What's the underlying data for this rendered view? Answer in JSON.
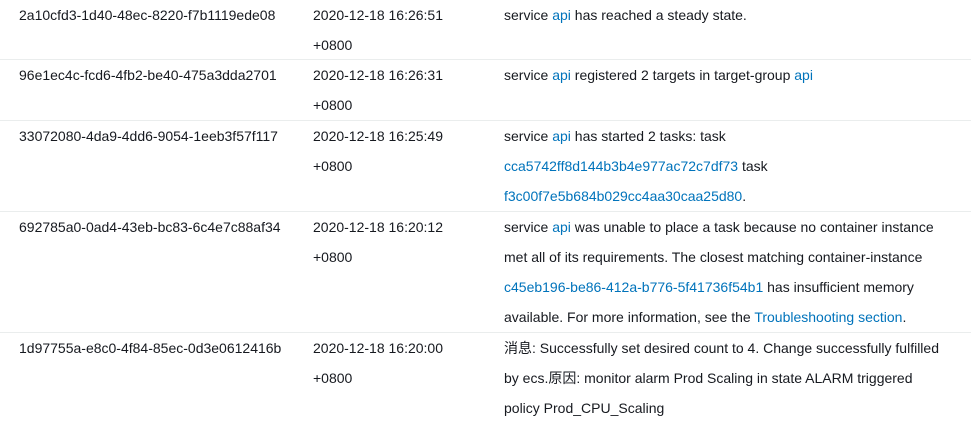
{
  "events": [
    {
      "id": "2a10cfd3-1d40-48ec-8220-f7b1119ede08",
      "time": "2020-12-18 16:26:51",
      "tz": "+0800",
      "msg_lines": [
        [
          {
            "t": "service "
          },
          {
            "t": "api",
            "link": true
          },
          {
            "t": " has reached a steady state."
          }
        ]
      ]
    },
    {
      "id": "96e1ec4c-fcd6-4fb2-be40-475a3dda2701",
      "time": "2020-12-18 16:26:31",
      "tz": "+0800",
      "msg_lines": [
        [
          {
            "t": "service "
          },
          {
            "t": "api",
            "link": true
          },
          {
            "t": " registered 2 targets in target-group "
          },
          {
            "t": "api",
            "link": true
          }
        ]
      ]
    },
    {
      "id": "33072080-4da9-4dd6-9054-1eeb3f57f117",
      "time": "2020-12-18 16:25:49",
      "tz": "+0800",
      "msg_lines": [
        [
          {
            "t": "service "
          },
          {
            "t": "api",
            "link": true
          },
          {
            "t": " has started 2 tasks: task"
          }
        ],
        [
          {
            "t": "cca5742ff8d144b3b4e977ac72c7df73",
            "link": true
          },
          {
            "t": " task"
          }
        ],
        [
          {
            "t": "f3c00f7e5b684b029cc4aa30caa25d80",
            "link": true
          },
          {
            "t": "."
          }
        ]
      ]
    },
    {
      "id": "692785a0-0ad4-43eb-bc83-6c4e7c88af34",
      "time": "2020-12-18 16:20:12",
      "tz": "+0800",
      "msg_lines": [
        [
          {
            "t": "service "
          },
          {
            "t": "api",
            "link": true
          },
          {
            "t": " was unable to place a task because no container instance"
          }
        ],
        [
          {
            "t": "met all of its requirements. The closest matching container-instance"
          }
        ],
        [
          {
            "t": "c45eb196-be86-412a-b776-5f41736f54b1",
            "link": true
          },
          {
            "t": " has insufficient memory"
          }
        ],
        [
          {
            "t": "available. For more information, see the "
          },
          {
            "t": "Troubleshooting section",
            "link": true
          },
          {
            "t": "."
          }
        ]
      ]
    },
    {
      "id": "1d97755a-e8c0-4f84-85ec-0d3e0612416b",
      "time": "2020-12-18 16:20:00",
      "tz": "+0800",
      "msg_lines": [
        [
          {
            "t": "消息: Successfully set desired count to 4. Change successfully fulfilled"
          }
        ],
        [
          {
            "t": "by ecs.原因: monitor alarm Prod Scaling in state ALARM triggered"
          }
        ],
        [
          {
            "t": "policy Prod_CPU_Scaling"
          }
        ]
      ]
    }
  ]
}
